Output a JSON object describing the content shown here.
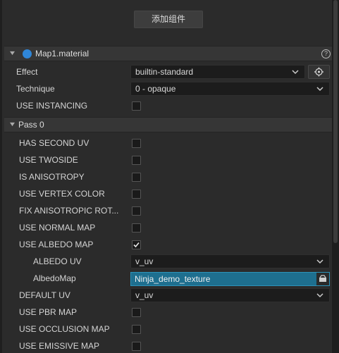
{
  "add_component_label": "添加组件",
  "material": {
    "title": "Map1.material",
    "help_glyph": "?"
  },
  "effect": {
    "label": "Effect",
    "value": "builtin-standard"
  },
  "technique": {
    "label": "Technique",
    "value": "0 - opaque"
  },
  "use_instancing": {
    "label": "USE INSTANCING",
    "checked": false
  },
  "pass": {
    "title": "Pass 0"
  },
  "props": [
    {
      "label": "HAS SECOND UV",
      "checked": false
    },
    {
      "label": "USE TWOSIDE",
      "checked": false
    },
    {
      "label": "IS ANISOTROPY",
      "checked": false
    },
    {
      "label": "USE VERTEX COLOR",
      "checked": false
    },
    {
      "label": "FIX ANISOTROPIC ROT...",
      "checked": false
    },
    {
      "label": "USE NORMAL MAP",
      "checked": false
    },
    {
      "label": "USE ALBEDO MAP",
      "checked": true
    }
  ],
  "albedo_uv": {
    "label": "ALBEDO UV",
    "value": "v_uv"
  },
  "albedo_map": {
    "label": "AlbedoMap",
    "value": "Ninja_demo_texture"
  },
  "default_uv": {
    "label": "DEFAULT UV",
    "value": "v_uv"
  },
  "props2": [
    {
      "label": "USE PBR MAP",
      "checked": false
    },
    {
      "label": "USE OCCLUSION MAP",
      "checked": false
    },
    {
      "label": "USE EMISSIVE MAP",
      "checked": false
    }
  ],
  "icons": {
    "caret": "caret-down-icon",
    "material": "material-sphere-icon",
    "help": "help-icon",
    "chevron": "chevron-down-icon",
    "target": "locate-icon",
    "check": "checkmark-icon",
    "asset": "asset-folder-icon"
  },
  "colors": {
    "accent": "#1e6f8f",
    "material_icon": "#2f86d8"
  }
}
